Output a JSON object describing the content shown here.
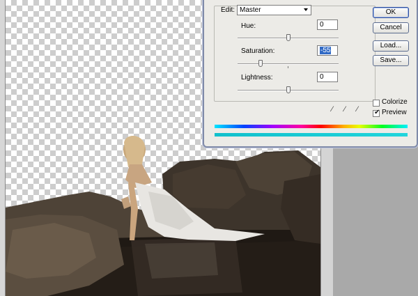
{
  "dialog": {
    "edit_label": "Edit:",
    "edit_value": "Master",
    "hue_label": "Hue:",
    "hue_value": "0",
    "saturation_label": "Saturation:",
    "saturation_value": "-55",
    "lightness_label": "Lightness:",
    "lightness_value": "0",
    "ok_label": "OK",
    "cancel_label": "Cancel",
    "load_label": "Load...",
    "save_label": "Save...",
    "colorize_label": "Colorize",
    "colorize_checked": false,
    "preview_label": "Preview",
    "preview_checked": true
  },
  "colors": {
    "selection": "#316ac5",
    "dialog_bg": "#ecebe7",
    "canvas_bg": "#a9a9a9"
  }
}
